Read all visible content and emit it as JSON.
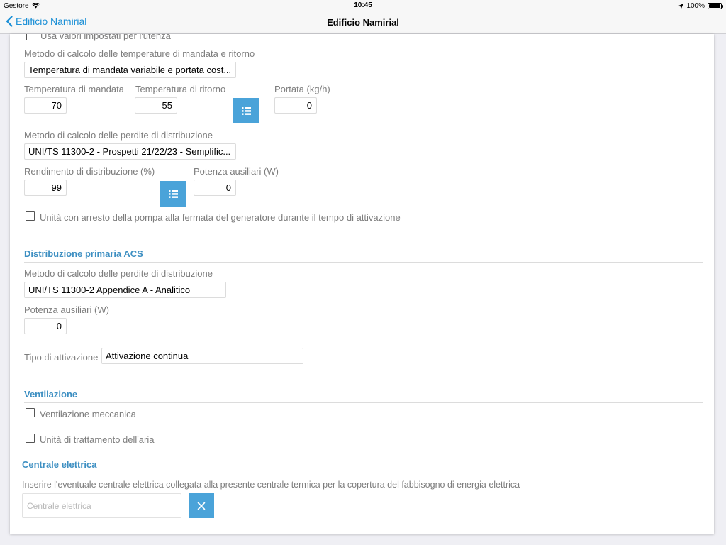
{
  "status": {
    "carrier": "Gestore",
    "time": "10:45",
    "battery": "100%"
  },
  "nav": {
    "back_label": "Edificio Namirial",
    "title": "Edificio Namirial"
  },
  "form": {
    "usa_valori_label": "Usa valori impostati per l'utenza",
    "metodo_temp_label": "Metodo di calcolo delle temperature di mandata e ritorno",
    "metodo_temp_value": "Temperatura di mandata variabile e portata cost...",
    "temp_mandata_label": "Temperatura di mandata",
    "temp_mandata_value": "70",
    "temp_ritorno_label": "Temperatura di ritorno",
    "temp_ritorno_value": "55",
    "portata_label": "Portata (kg/h)",
    "portata_value": "0",
    "metodo_perdite_label": "Metodo di calcolo delle perdite di distribuzione",
    "metodo_perdite_value": "UNI/TS 11300-2 - Prospetti 21/22/23 - Semplific...",
    "rendimento_label": "Rendimento di distribuzione (%)",
    "rendimento_value": "99",
    "potenza_aux_label": "Potenza ausiliari (W)",
    "potenza_aux_value": "0",
    "arresto_pompa_label": "Unità con arresto della pompa alla fermata del generatore durante il tempo di attivazione"
  },
  "acs": {
    "section_title": "Distribuzione primaria ACS",
    "metodo_perdite_label": "Metodo di calcolo delle perdite di distribuzione",
    "metodo_perdite_value": "UNI/TS 11300-2 Appendice A - Analitico",
    "potenza_aux_label": "Potenza ausiliari (W)",
    "potenza_aux_value": "0",
    "tipo_attivazione_label": "Tipo di attivazione",
    "tipo_attivazione_value": "Attivazione continua"
  },
  "ventilazione": {
    "section_title": "Ventilazione",
    "meccanica_label": "Ventilazione meccanica",
    "uta_label": "Unità di trattamento dell'aria"
  },
  "centrale": {
    "section_title": "Centrale elettrica",
    "description": "Inserire l'eventuale centrale elettrica collegata alla presente centrale termica per la copertura del fabbisogno di energia elettrica",
    "input_placeholder": "Centrale elettrica"
  },
  "colors": {
    "accent": "#4aa3d9",
    "section": "#3d8fc2",
    "link": "#1a8fd6"
  },
  "icons": {
    "list": "list-icon",
    "clear": "close-icon",
    "back": "chevron-left-icon"
  }
}
